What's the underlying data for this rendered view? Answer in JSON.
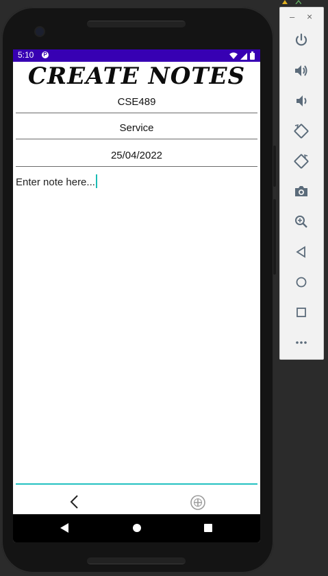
{
  "status_bar": {
    "time": "5:10",
    "app_icon": "P",
    "icons": [
      "wifi-icon",
      "signal-icon",
      "battery-icon"
    ],
    "color": "#3700b3"
  },
  "screen": {
    "title": "CREATE NOTES",
    "subject_field": {
      "value": "CSE489"
    },
    "category_field": {
      "value": "Service"
    },
    "date_field": {
      "value": "25/04/2022"
    },
    "note_field": {
      "placeholder": "Enter note here..."
    },
    "accent_color": "#23c1c1"
  },
  "actions": {
    "back_icon": "chevron-left-icon",
    "add_icon": "add-circle-icon"
  },
  "nav_bar": {
    "buttons": [
      "nav-back-icon",
      "nav-home-icon",
      "nav-recents-icon"
    ]
  },
  "emulator_panel": {
    "minimize_label": "–",
    "close_label": "×",
    "buttons": [
      "power-icon",
      "volume-up-icon",
      "volume-down-icon",
      "rotate-left-icon",
      "rotate-right-icon",
      "camera-icon",
      "zoom-icon",
      "back-icon",
      "home-icon",
      "overview-icon",
      "more-icon"
    ]
  }
}
